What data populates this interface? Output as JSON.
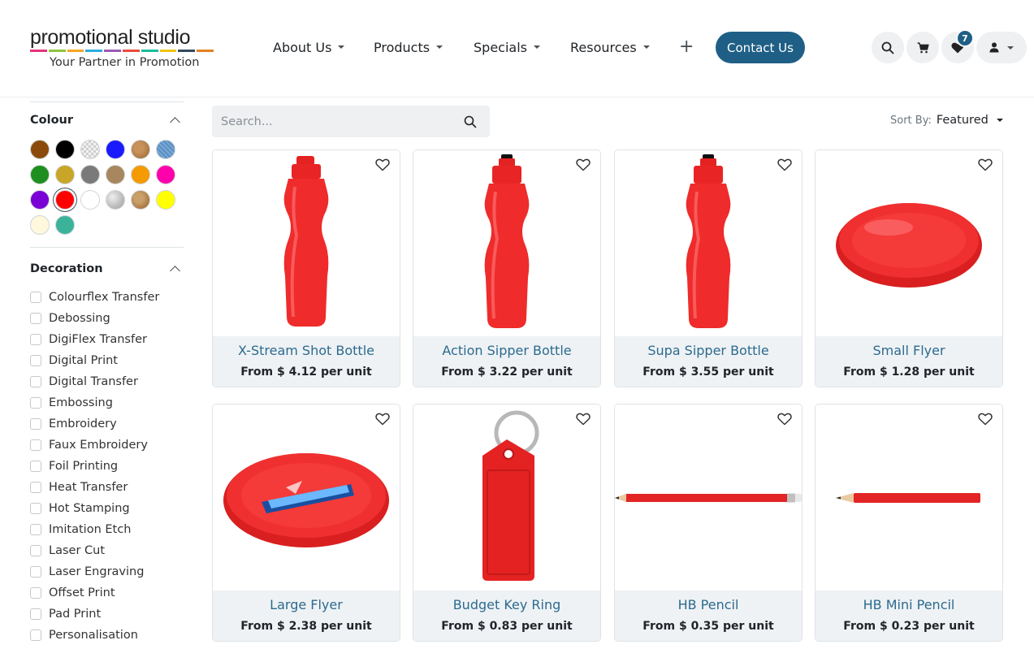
{
  "brand": {
    "name_part1": "promotional",
    "name_part2": " studio",
    "tagline": "Your Partner in Promotion",
    "stripe_colors": [
      "#e6337a",
      "#8cc63f",
      "#f6a623",
      "#29abe2",
      "#9b59b6",
      "#e74c3c",
      "#1abc9c",
      "#f1c40f",
      "#34495e",
      "#e67e22"
    ]
  },
  "nav": {
    "items": [
      {
        "label": "About Us"
      },
      {
        "label": "Products"
      },
      {
        "label": "Specials"
      },
      {
        "label": "Resources"
      }
    ],
    "plus_label": "+",
    "contact_label": "Contact Us",
    "wishlist_count": "7"
  },
  "sidebar": {
    "colour_title": "Colour",
    "colours": [
      "#8b4a0b",
      "#000000",
      "#dcdcdc",
      "#1a1aff",
      "#c8925a",
      "#5a8fc2",
      "#1e8f1e",
      "#c9a628",
      "#7a7a7a",
      "#a8875e",
      "#f59a00",
      "#ff00aa",
      "#7a00d6",
      "#ff0000",
      "#ffffff",
      "#b8b8b8",
      "#c9a06a",
      "#ffff00",
      "#fff8dc",
      "#3ab39a"
    ],
    "selected_colour_index": 13,
    "decoration_title": "Decoration",
    "decorations": [
      "Colourflex Transfer",
      "Debossing",
      "DigiFlex Transfer",
      "Digital Print",
      "Digital Transfer",
      "Embossing",
      "Embroidery",
      "Faux Embroidery",
      "Foil Printing",
      "Heat Transfer",
      "Hot Stamping",
      "Imitation Etch",
      "Laser Cut",
      "Laser Engraving",
      "Offset Print",
      "Pad Print",
      "Personalisation"
    ]
  },
  "search": {
    "placeholder": "Search..."
  },
  "sort": {
    "label": "Sort By:",
    "value": "Featured"
  },
  "products": [
    {
      "name": "X-Stream Shot Bottle",
      "price": "From $ 4.12 per unit",
      "image": "bottle-flip-cap"
    },
    {
      "name": "Action Sipper Bottle",
      "price": "From $ 3.22 per unit",
      "image": "bottle-sipper"
    },
    {
      "name": "Supa Sipper Bottle",
      "price": "From $ 3.55 per unit",
      "image": "bottle-sipper"
    },
    {
      "name": "Small Flyer",
      "price": "From $ 1.28 per unit",
      "image": "frisbee"
    },
    {
      "name": "Large Flyer",
      "price": "From $ 2.38 per unit",
      "image": "frisbee-printed"
    },
    {
      "name": "Budget Key Ring",
      "price": "From $ 0.83 per unit",
      "image": "key-ring"
    },
    {
      "name": "HB Pencil",
      "price": "From $ 0.35 per unit",
      "image": "pencil"
    },
    {
      "name": "HB Mini Pencil",
      "price": "From $ 0.23 per unit",
      "image": "mini-pencil"
    }
  ]
}
